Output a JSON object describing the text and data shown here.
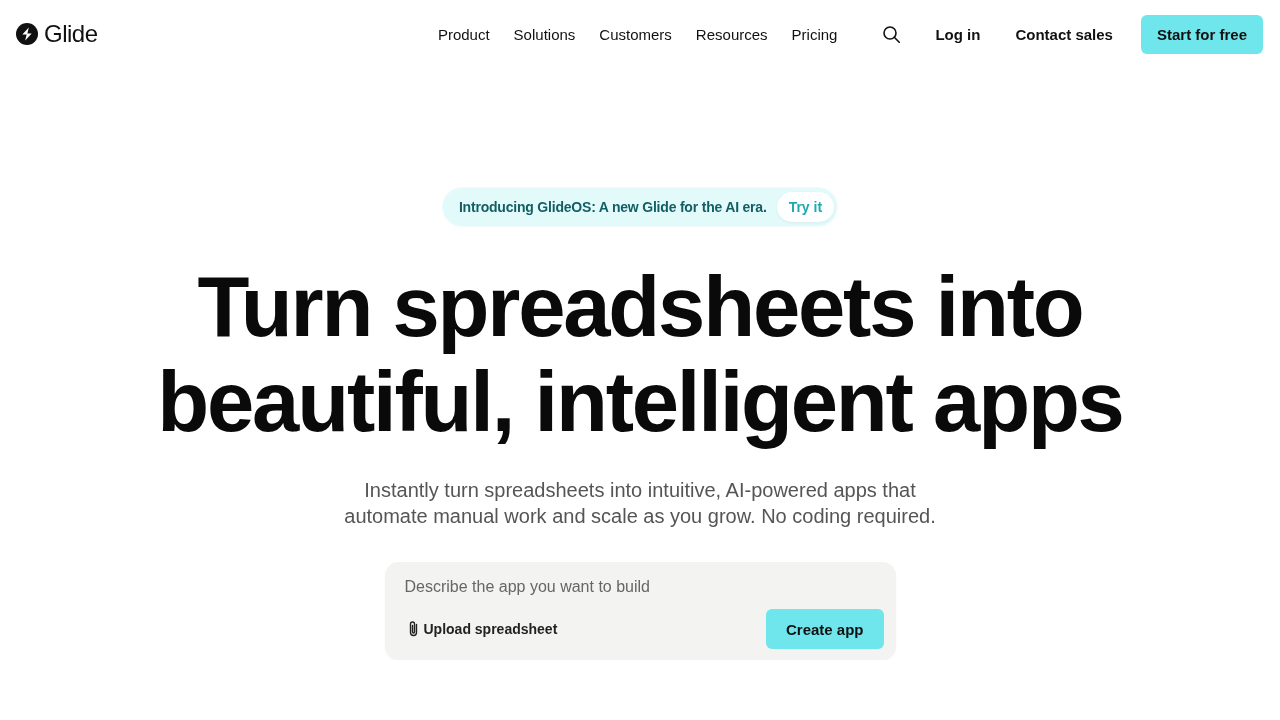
{
  "header": {
    "logo": "Glide",
    "nav": [
      "Product",
      "Solutions",
      "Customers",
      "Resources",
      "Pricing"
    ],
    "login": "Log in",
    "contact": "Contact sales",
    "cta": "Start for free"
  },
  "banner": {
    "text": "Introducing GlideOS: A new Glide for the AI era.",
    "action": "Try it"
  },
  "hero": {
    "headline": "Turn spreadsheets into beautiful, intelligent apps",
    "subtitle": "Instantly turn spreadsheets into intuitive, AI-powered apps that automate manual work and scale as you grow. No coding required."
  },
  "prompt": {
    "placeholder": "Describe the app you want to build",
    "upload": "Upload spreadsheet",
    "submit": "Create app"
  }
}
